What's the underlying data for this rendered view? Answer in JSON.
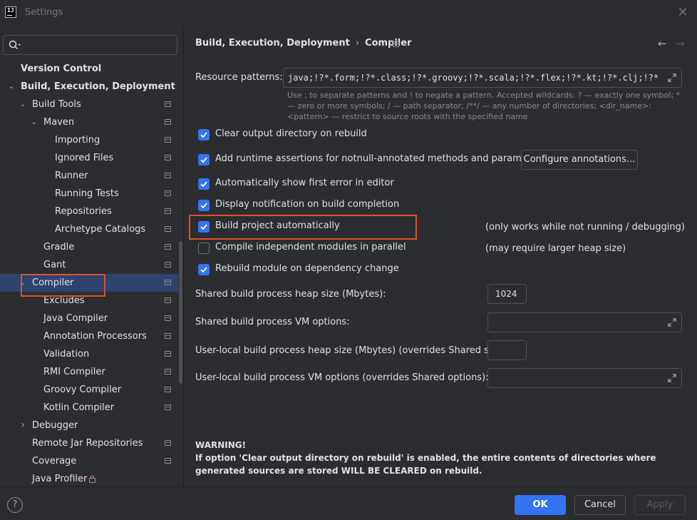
{
  "window": {
    "title": "Settings"
  },
  "search": {
    "placeholder": ""
  },
  "tree": [
    {
      "label": "Version Control",
      "bold": true,
      "indent": 0,
      "arrow": "",
      "page": false
    },
    {
      "label": "Build, Execution, Deployment",
      "bold": true,
      "indent": 0,
      "arrow": "down",
      "page": false
    },
    {
      "label": "Build Tools",
      "bold": false,
      "indent": 1,
      "arrow": "down",
      "page": true
    },
    {
      "label": "Maven",
      "bold": false,
      "indent": 2,
      "arrow": "down",
      "page": true
    },
    {
      "label": "Importing",
      "bold": false,
      "indent": 3,
      "arrow": "",
      "page": true
    },
    {
      "label": "Ignored Files",
      "bold": false,
      "indent": 3,
      "arrow": "",
      "page": true
    },
    {
      "label": "Runner",
      "bold": false,
      "indent": 3,
      "arrow": "",
      "page": true
    },
    {
      "label": "Running Tests",
      "bold": false,
      "indent": 3,
      "arrow": "",
      "page": true
    },
    {
      "label": "Repositories",
      "bold": false,
      "indent": 3,
      "arrow": "",
      "page": true
    },
    {
      "label": "Archetype Catalogs",
      "bold": false,
      "indent": 3,
      "arrow": "",
      "page": true
    },
    {
      "label": "Gradle",
      "bold": false,
      "indent": 2,
      "arrow": "",
      "page": true
    },
    {
      "label": "Gant",
      "bold": false,
      "indent": 2,
      "arrow": "",
      "page": true
    },
    {
      "label": "Compiler",
      "bold": false,
      "indent": 1,
      "arrow": "down",
      "page": true,
      "selected": true
    },
    {
      "label": "Excludes",
      "bold": false,
      "indent": 2,
      "arrow": "",
      "page": true
    },
    {
      "label": "Java Compiler",
      "bold": false,
      "indent": 2,
      "arrow": "",
      "page": true
    },
    {
      "label": "Annotation Processors",
      "bold": false,
      "indent": 2,
      "arrow": "",
      "page": true
    },
    {
      "label": "Validation",
      "bold": false,
      "indent": 2,
      "arrow": "",
      "page": true
    },
    {
      "label": "RMI Compiler",
      "bold": false,
      "indent": 2,
      "arrow": "",
      "page": true
    },
    {
      "label": "Groovy Compiler",
      "bold": false,
      "indent": 2,
      "arrow": "",
      "page": true
    },
    {
      "label": "Kotlin Compiler",
      "bold": false,
      "indent": 2,
      "arrow": "",
      "page": true
    },
    {
      "label": "Debugger",
      "bold": false,
      "indent": 1,
      "arrow": "right",
      "page": false
    },
    {
      "label": "Remote Jar Repositories",
      "bold": false,
      "indent": 1,
      "arrow": "",
      "page": true
    },
    {
      "label": "Coverage",
      "bold": false,
      "indent": 1,
      "arrow": "",
      "page": true
    },
    {
      "label": "Java Profiler",
      "bold": false,
      "indent": 1,
      "arrow": "",
      "page": false,
      "lock": true
    }
  ],
  "breadcrumb": {
    "parent": "Build, Execution, Deployment",
    "current": "Compiler"
  },
  "resource": {
    "label": "Resource patterns:",
    "value": "java;!?*.form;!?*.class;!?*.groovy;!?*.scala;!?*.flex;!?*.kt;!?*.clj;!?*.aj",
    "hint": "Use ; to separate patterns and ! to negate a pattern. Accepted wildcards: ? — exactly one symbol; * — zero or more symbols; / — path separator; /**/ — any number of directories; <dir_name>:<pattern> — restrict to source roots with the specified name"
  },
  "options": {
    "clear_output": "Clear output directory on rebuild",
    "runtime_assertions": "Add runtime assertions for notnull-annotated methods and parameters",
    "configure_annotations": "Configure annotations...",
    "show_first_error": "Automatically show first error in editor",
    "display_notification": "Display notification on build completion",
    "build_automatically": "Build project automatically",
    "build_automatically_note": "(only works while not running / debugging)",
    "compile_parallel": "Compile independent modules in parallel",
    "compile_parallel_note": "(may require larger heap size)",
    "rebuild_on_dependency": "Rebuild module on dependency change"
  },
  "checks": {
    "clear_output": true,
    "runtime_assertions": true,
    "show_first_error": true,
    "display_notification": true,
    "build_automatically": true,
    "compile_parallel": false,
    "rebuild_on_dependency": true
  },
  "heap": {
    "shared_heap_label": "Shared build process heap size (Mbytes):",
    "shared_heap_value": "1024",
    "shared_vm_label": "Shared build process VM options:",
    "shared_vm_value": "",
    "user_heap_label": "User-local build process heap size (Mbytes) (overrides Shared size):",
    "user_heap_value": "",
    "user_vm_label": "User-local build process VM options (overrides Shared options):",
    "user_vm_value": ""
  },
  "warning": {
    "title": "WARNING!",
    "text": "If option 'Clear output directory on rebuild' is enabled, the entire contents of directories where generated sources are stored WILL BE CLEARED on rebuild."
  },
  "footer": {
    "help": "?",
    "ok": "OK",
    "cancel": "Cancel",
    "apply": "Apply"
  },
  "colors": {
    "accent": "#3574f0",
    "highlight": "#e0522a",
    "background": "#2b2d30",
    "selection": "#2e436e"
  }
}
